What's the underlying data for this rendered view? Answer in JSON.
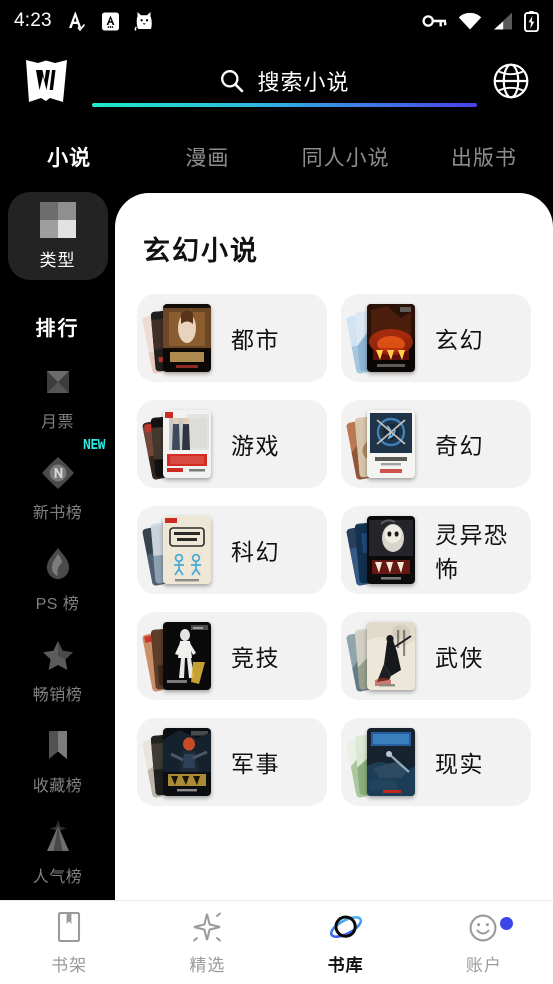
{
  "statusbar": {
    "time": "4:23",
    "left_icons": [
      "a-check-icon",
      "a-box-icon",
      "cat-face-icon"
    ],
    "right_icons": [
      "vpn-key-icon",
      "wifi-icon",
      "cellular-signal-icon",
      "battery-charging-icon"
    ]
  },
  "header": {
    "logo": "w-logo",
    "search_placeholder": "搜索小说",
    "search_icon": "search-icon",
    "globe_icon": "globe-icon",
    "underline_gradient_start": "#1ee8c8",
    "underline_gradient_end": "#4a42e8"
  },
  "tabs": [
    {
      "label": "小说",
      "active": true
    },
    {
      "label": "漫画",
      "active": false
    },
    {
      "label": "同人小说",
      "active": false
    },
    {
      "label": "出版书",
      "active": false
    }
  ],
  "sidebar": {
    "type_item": {
      "label": "类型",
      "icon": "grid-icon",
      "selected": true
    },
    "section_header": "排行",
    "items": [
      {
        "label": "月票",
        "icon": "diamond-icon",
        "badge": ""
      },
      {
        "label": "新书榜",
        "icon": "n-badge-icon",
        "badge": "NEW"
      },
      {
        "label": "PS 榜",
        "icon": "flame-icon",
        "badge": ""
      },
      {
        "label": "畅销榜",
        "icon": "star-icon",
        "badge": ""
      },
      {
        "label": "收藏榜",
        "icon": "bookmark-icon",
        "badge": ""
      },
      {
        "label": "人气榜",
        "icon": "rocket-icon",
        "badge": ""
      }
    ]
  },
  "main": {
    "title": "玄幻小说",
    "categories": [
      {
        "label": "都市",
        "cover": "cover-dushi"
      },
      {
        "label": "玄幻",
        "cover": "cover-xuanhuan"
      },
      {
        "label": "游戏",
        "cover": "cover-youxi"
      },
      {
        "label": "奇幻",
        "cover": "cover-qihuan"
      },
      {
        "label": "科幻",
        "cover": "cover-kehuan"
      },
      {
        "label": "灵异恐怖",
        "cover": "cover-lingyi"
      },
      {
        "label": "竞技",
        "cover": "cover-jingji"
      },
      {
        "label": "武侠",
        "cover": "cover-wuxia"
      },
      {
        "label": "军事",
        "cover": "cover-junshi"
      },
      {
        "label": "现实",
        "cover": "cover-xianshi"
      }
    ]
  },
  "bottomnav": [
    {
      "label": "书架",
      "icon": "book-icon",
      "active": false,
      "badge": false
    },
    {
      "label": "精选",
      "icon": "sparkle-icon",
      "active": false,
      "badge": false
    },
    {
      "label": "书库",
      "icon": "planet-icon",
      "active": true,
      "badge": false
    },
    {
      "label": "账户",
      "icon": "smiley-icon",
      "active": false,
      "badge": true
    }
  ]
}
